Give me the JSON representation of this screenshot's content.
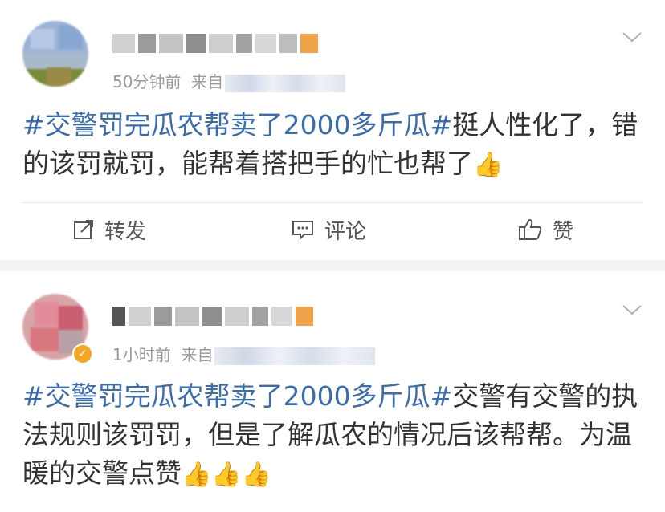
{
  "posts": [
    {
      "time": "50分钟前",
      "source_prefix": "来自",
      "topic": "#交警罚完瓜农帮卖了2000多斤瓜#",
      "text": "挺人性化了，错的该罚就罚，能帮着搭把手的忙也帮了",
      "emoji": "👍",
      "actions": {
        "repost": "转发",
        "comment": "评论",
        "like": "赞"
      }
    },
    {
      "time": "1小时前",
      "source_prefix": "来自",
      "topic": "#交警罚完瓜农帮卖了2000多斤瓜#",
      "text": "交警有交警的执法规则该罚罚，但是了解瓜农的情况后该帮帮。为温暖的交警点赞",
      "emoji": "👍👍👍"
    }
  ],
  "colors": {
    "topic": "#3a6cb0",
    "meta": "#999999",
    "separator": "#f2f2f2",
    "verified_badge": "#f5a623"
  },
  "icons": [
    "repost-icon",
    "comment-icon",
    "like-icon",
    "chevron-down-icon",
    "verified-badge-icon"
  ]
}
